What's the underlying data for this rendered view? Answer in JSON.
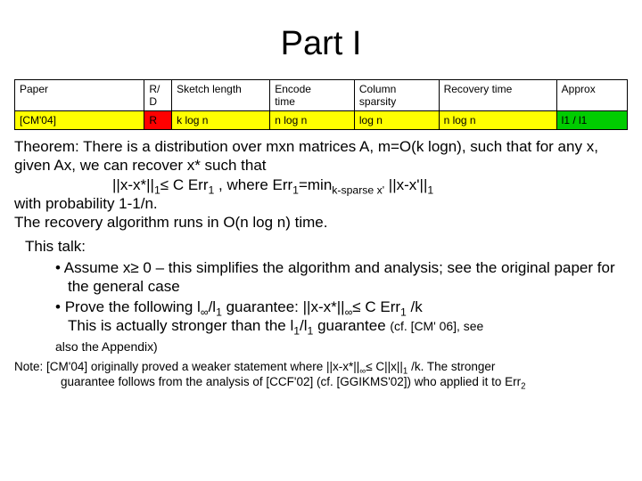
{
  "title": "Part I",
  "table": {
    "headers": [
      "Paper",
      "R/\nD",
      "Sketch length",
      "Encode time",
      "Column sparsity",
      "Recovery time",
      "Approx"
    ],
    "row_cm": {
      "paper": "[CM'04]",
      "rd": "R",
      "sketch": "k log n",
      "encode": "n log n",
      "sparsity": "log n",
      "recovery": "n log n",
      "approx": "l1 / l1"
    }
  },
  "theorem": {
    "p1": "Theorem: There is a distribution over mxn matrices A, m=O(k logn), such that for any x, given Ax, we can recover x* such that",
    "eq_pre": "||x-x*||",
    "eq_sub1": "1",
    "eq_mid": "≤ C Err",
    "eq_sub2": "1",
    "eq_comma": " , where Err",
    "eq_sub3": "1",
    "eq_min": "=min",
    "eq_min_sub": "k-sparse  x'",
    "eq_tail": " ||x-x'||",
    "eq_sub4": "1",
    "p2": "with probability 1-1/n.",
    "p3": "The recovery algorithm runs in O(n log n) time."
  },
  "talk": {
    "heading": "This talk:",
    "b1": "Assume x≥ 0 – this simplifies the algorithm and analysis; see the original paper for the general case",
    "b2_pre": "Prove the following l",
    "b2_inf": "∞",
    "b2_slash": "/l",
    "b2_sub1": "1",
    "b2_gaur": " guarantee: ||x-x*||",
    "b2_subinf": "∞",
    "b2_le": "≤ C Err",
    "b2_sub2": "1",
    "b2_k": " /k",
    "b2_line2a": "This is actually stronger than the l",
    "b2_line2_sub1": "1",
    "b2_line2b": "/l",
    "b2_line2_sub2": "1",
    "b2_line2c": " guarantee ",
    "b2_line2_cf": "(cf. [CM' 06], see",
    "b2_line3": "also the Appendix)"
  },
  "note": {
    "l1a": "Note: [CM'04] originally proved a weaker statement where ||x-x*||",
    "l1_subinf": "∞",
    "l1b": "≤ C||x||",
    "l1_sub1": "1",
    "l1c": " /k. The stronger",
    "l2a": "guarantee follows from the analysis of [CCF'02] (cf. [GGIKMS'02]) who applied it to Err",
    "l2_sub": "2"
  }
}
